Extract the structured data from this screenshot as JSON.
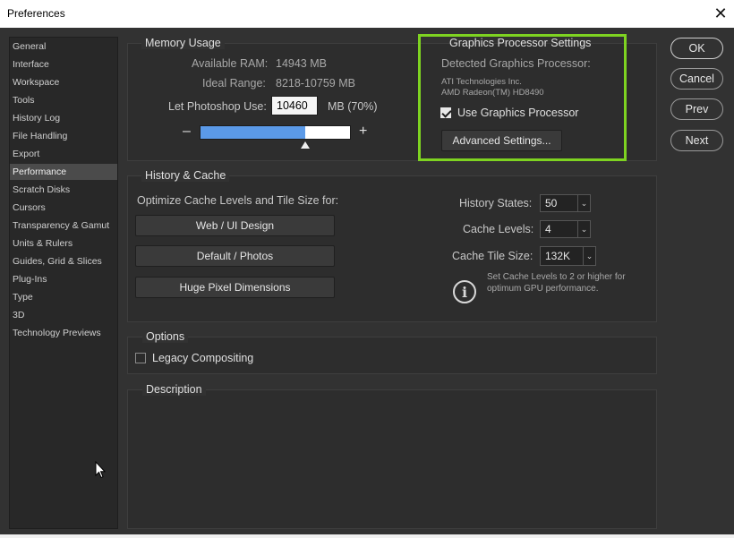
{
  "window": {
    "title": "Preferences",
    "close_glyph": "✕"
  },
  "sidebar": {
    "items": [
      {
        "label": "General"
      },
      {
        "label": "Interface"
      },
      {
        "label": "Workspace"
      },
      {
        "label": "Tools"
      },
      {
        "label": "History Log"
      },
      {
        "label": "File Handling"
      },
      {
        "label": "Export"
      },
      {
        "label": "Performance",
        "active": true
      },
      {
        "label": "Scratch Disks"
      },
      {
        "label": "Cursors"
      },
      {
        "label": "Transparency & Gamut"
      },
      {
        "label": "Units & Rulers"
      },
      {
        "label": "Guides, Grid & Slices"
      },
      {
        "label": "Plug-Ins"
      },
      {
        "label": "Type"
      },
      {
        "label": "3D"
      },
      {
        "label": "Technology Previews"
      }
    ]
  },
  "memory": {
    "title": "Memory Usage",
    "available_label": "Available RAM:",
    "available_value": "14943 MB",
    "ideal_label": "Ideal Range:",
    "ideal_value": "8218-10759 MB",
    "let_label": "Let Photoshop Use:",
    "let_value": "10460",
    "unit_label": "MB (70%)",
    "minus": "–",
    "plus": "+",
    "slider_fraction": 0.7
  },
  "gpu": {
    "title": "Graphics Processor Settings",
    "detected_label": "Detected Graphics Processor:",
    "vendor": "ATI Technologies Inc.",
    "model": "AMD Radeon(TM) HD8490",
    "use_label": "Use Graphics Processor",
    "use_checked": true,
    "advanced_button": "Advanced Settings...",
    "highlight_color": "#7ed321"
  },
  "history_cache": {
    "title": "History & Cache",
    "optimize_label": "Optimize Cache Levels and Tile Size for:",
    "buttons": [
      "Web / UI Design",
      "Default / Photos",
      "Huge Pixel Dimensions"
    ],
    "history_states_label": "History States:",
    "history_states_value": "50",
    "cache_levels_label": "Cache Levels:",
    "cache_levels_value": "4",
    "tile_size_label": "Cache Tile Size:",
    "tile_size_value": "132K",
    "info_line1": "Set Cache Levels to 2 or higher for",
    "info_line2": "optimum GPU performance.",
    "info_glyph": "i",
    "chevron_glyph": "⌄"
  },
  "options": {
    "title": "Options",
    "legacy_label": "Legacy Compositing",
    "legacy_checked": false
  },
  "description": {
    "title": "Description"
  },
  "actions": {
    "ok": "OK",
    "cancel": "Cancel",
    "prev": "Prev",
    "next": "Next"
  }
}
